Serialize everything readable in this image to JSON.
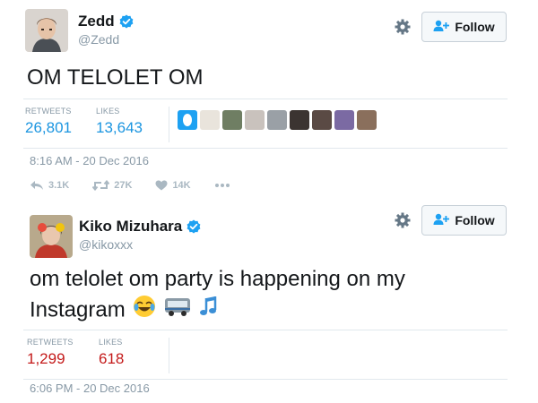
{
  "tweets": [
    {
      "display_name": "Zedd",
      "handle": "@Zedd",
      "verified": true,
      "follow_label": "Follow",
      "text": "OM TELOLET OM",
      "stats": {
        "retweets_label": "RETWEETS",
        "retweets_value": "26,801",
        "likes_label": "LIKES",
        "likes_value": "13,643"
      },
      "timestamp": "8:16 AM - 20 Dec 2016",
      "actions": {
        "reply_count": "3.1K",
        "retweet_count": "27K",
        "like_count": "14K"
      },
      "colors": {
        "stat_value": "#1b95e0"
      }
    },
    {
      "display_name": "Kiko Mizuhara",
      "handle": "@kikoxxx",
      "verified": true,
      "follow_label": "Follow",
      "text": "om telolet om party is happening on my Instagram",
      "emojis": [
        "face-with-tears-of-joy",
        "bus",
        "musical-notes"
      ],
      "stats": {
        "retweets_label": "RETWEETS",
        "retweets_value": "1,299",
        "likes_label": "LIKES",
        "likes_value": "618"
      },
      "timestamp": "6:06 PM - 20 Dec 2016",
      "colors": {
        "stat_value": "#c41a1a"
      }
    }
  ],
  "colors": {
    "brand_blue": "#1da1f2",
    "muted_text": "#8899a6",
    "border": "#e1e8ed"
  }
}
